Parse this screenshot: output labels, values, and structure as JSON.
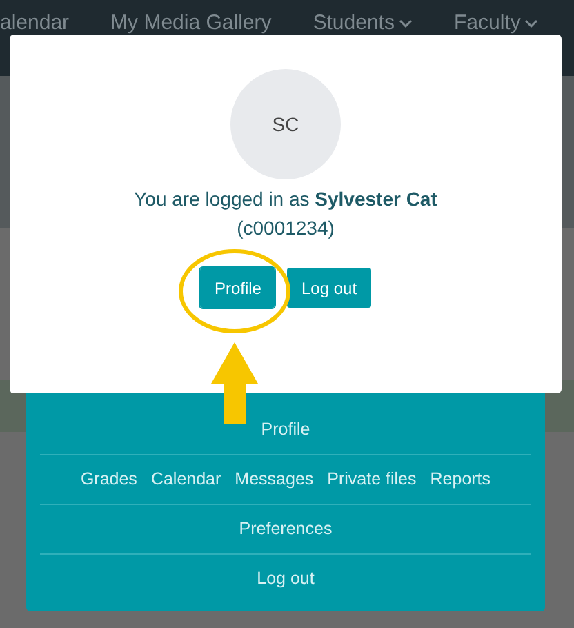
{
  "nav": [
    {
      "label": "alendar",
      "dropdown": false
    },
    {
      "label": "My Media Gallery",
      "dropdown": false
    },
    {
      "label": "Students",
      "dropdown": true
    },
    {
      "label": "Faculty",
      "dropdown": true
    }
  ],
  "modal": {
    "avatar_initials": "SC",
    "message": "You are logged in as **Sylvester Cat**",
    "user_id": "(c0001234)",
    "buttons": [
      {
        "label": "Profile",
        "highlighted": true
      },
      {
        "label": "Log out",
        "highlighted": false
      }
    ]
  },
  "menu": {
    "rows": [
      {
        "items": [
          "Profile"
        ]
      },
      {
        "items": [
          "Grades",
          "Calendar",
          "Messages",
          "Private files",
          "Reports"
        ]
      },
      {
        "items": [
          "Preferences"
        ]
      },
      {
        "items": [
          "Log out"
        ]
      }
    ]
  }
}
